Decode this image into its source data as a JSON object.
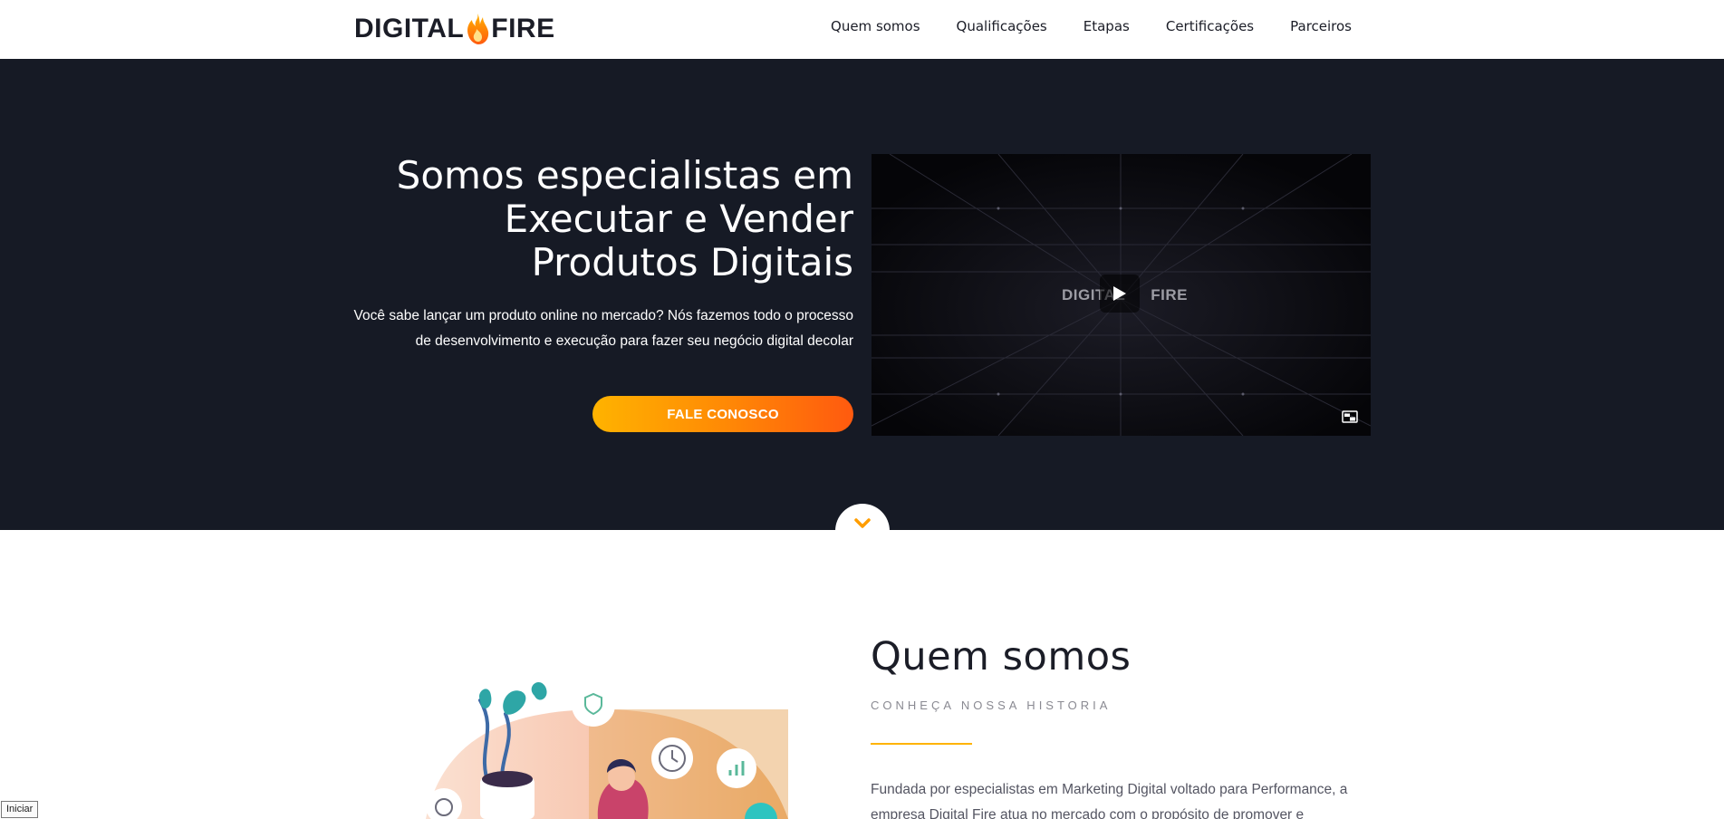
{
  "brand": {
    "logo_left": "DIGITAL",
    "logo_right": "FIRE",
    "accent": "#ff8a05",
    "accent_light": "#ffb300",
    "accent_dark": "#ff5a0f",
    "dark_bg": "#161a25"
  },
  "nav": {
    "items": [
      {
        "label": "Quem somos"
      },
      {
        "label": "Qualificações"
      },
      {
        "label": "Etapas"
      },
      {
        "label": "Certificações"
      },
      {
        "label": "Parceiros"
      }
    ]
  },
  "hero": {
    "title_line1": "Somos especialistas em",
    "title_line2": "Executar e Vender",
    "title_line3": "Produtos Digitais",
    "subtitle_line1": "Você sabe lançar um produto online no mercado? Nós fazemos todo o processo",
    "subtitle_line2": "de desenvolvimento e execução para fazer seu negócio digital decolar",
    "cta_label": "FALE CONOSCO",
    "video": {
      "logo_left": "DIGITAL",
      "logo_right": "FIRE",
      "play_icon": "play-icon",
      "pip_icon": "picture-in-picture-icon"
    },
    "scroll_icon": "chevron-down-icon"
  },
  "about": {
    "title": "Quem somos",
    "subtitle": "CONHEÇA NOSSA HISTORIA",
    "text_line1": "Fundada por especialistas em Marketing Digital voltado para Performance, a",
    "text_line2": "empresa Digital Fire atua no mercado com o propósito de promover e"
  },
  "corner_button": {
    "label": "Iniciar"
  }
}
